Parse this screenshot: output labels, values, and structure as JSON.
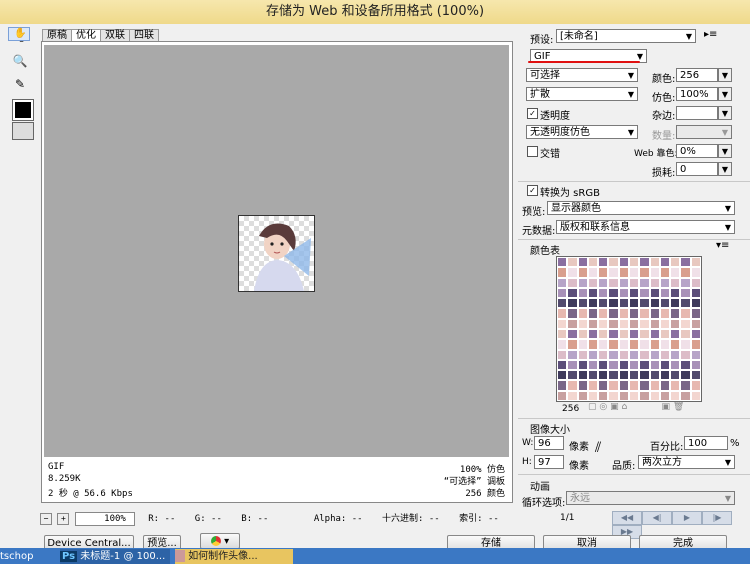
{
  "window": {
    "title": "存储为 Web 和设备所用格式 (100%)"
  },
  "tools": [
    "hand-tool",
    "slice-select-tool",
    "zoom-tool",
    "eyedropper-tool"
  ],
  "tabs": [
    "原稿",
    "优化",
    "双联",
    "四联"
  ],
  "info": {
    "format": "GIF",
    "size": "8.259K",
    "time": "2 秒 @ 56.6 Kbps",
    "dither": "100% 仿色",
    "palette": "“可选择” 调板",
    "colors": "256 颜色"
  },
  "bottom": {
    "zoom": "100%",
    "r": "R: --",
    "g": "G: --",
    "b": "B: --",
    "alpha": "Alpha: --",
    "hex": "十六进制: --",
    "index": "索引: --"
  },
  "settings": {
    "preset_label": "预设:",
    "preset_value": "[未命名]",
    "format": "GIF",
    "reduction": "可选择",
    "dither_algo": "扩散",
    "transparency_label": "透明度",
    "transparency_dither": "无透明度仿色",
    "interlaced_label": "交错",
    "colors_label": "颜色:",
    "colors_value": "256",
    "dither_label": "仿色:",
    "dither_value": "100%",
    "matte_label": "杂边:",
    "matte_value": "",
    "amount_label": "数量:",
    "web_snap_label": "Web 靠色:",
    "web_snap_value": "0%",
    "lossy_label": "损耗:",
    "lossy_value": "0",
    "convert_srgb": "转换为 sRGB",
    "preview_label": "预览:",
    "preview_value": "显示器颜色",
    "metadata_label": "元数据:",
    "metadata_value": "版权和联系信息"
  },
  "color_table": {
    "title": "颜色表",
    "count": "256",
    "colors": [
      "#8a6fa0",
      "#e7b8b0",
      "#5c4e7a",
      "#d99f8e",
      "#f3d6d0",
      "#3f3a5c",
      "#b7a4c8",
      "#e8c8c0",
      "#7a6688",
      "#a890b8",
      "#f0e0e8",
      "#c8a0a0",
      "#524a6e",
      "#dcbcc8"
    ]
  },
  "image_size": {
    "title": "图像大小",
    "w_label": "W:",
    "w_value": "96",
    "h_label": "H:",
    "h_value": "97",
    "unit": "像素",
    "percent_label": "百分比:",
    "percent_value": "100",
    "percent_unit": "%",
    "quality_label": "品质:",
    "quality_value": "两次立方"
  },
  "animation": {
    "title": "动画",
    "loop_label": "循环选项:",
    "loop_value": "永远",
    "frame": "1/1"
  },
  "buttons": {
    "device_central": "Device Central...",
    "preview": "预览...",
    "save": "存储",
    "cancel": "取消",
    "done": "完成"
  },
  "taskbar": {
    "left_app": "tschop",
    "ps_item": "未标题-1 @ 100...",
    "other_item": "如何制作头像..."
  }
}
